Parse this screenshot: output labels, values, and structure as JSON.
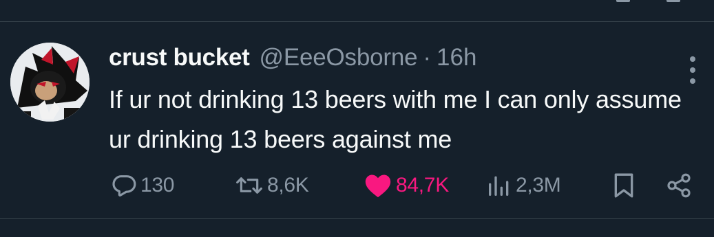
{
  "tweet": {
    "display_name": "crust bucket",
    "handle": "@EeeOsborne",
    "separator": "·",
    "time": "16h",
    "text": "If ur not drinking 13 beers with me I can only assume ur drinking 13 beers against me"
  },
  "metrics": {
    "replies": "130",
    "retweets": "8,6K",
    "likes": "84,7K",
    "views": "2,3M"
  },
  "icons": {
    "avatar": "shadow-hedgehog-avatar",
    "reply": "speech-bubble-icon",
    "retweet": "retweet-arrows-icon",
    "like": "heart-icon",
    "views": "bar-chart-icon",
    "bookmark": "bookmark-icon",
    "share": "share-icon",
    "more": "vertical-ellipsis-icon"
  },
  "colors": {
    "background": "#15202b",
    "divider": "#38444d",
    "text_primary": "#f7f9f9",
    "text_secondary": "#8b98a5",
    "like_active": "#f91880"
  }
}
